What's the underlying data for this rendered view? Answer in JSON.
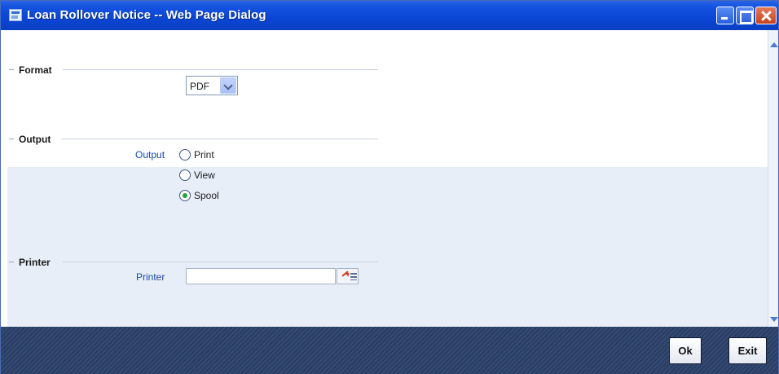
{
  "window": {
    "title": "Loan Rollover Notice -- Web Page Dialog"
  },
  "format_section": {
    "title": "Format",
    "select_value": "PDF"
  },
  "output_section": {
    "title": "Output",
    "field_label": "Output",
    "options": [
      {
        "label": "Print",
        "checked": false
      },
      {
        "label": "View",
        "checked": false
      },
      {
        "label": "Spool",
        "checked": true
      }
    ]
  },
  "printer_section": {
    "title": "Printer",
    "field_label": "Printer",
    "value": ""
  },
  "footer": {
    "ok_label": "Ok",
    "exit_label": "Exit"
  },
  "colors": {
    "titlebar": "#0a46d4",
    "footer": "#2a3d62",
    "lower_panel": "#e8eef7",
    "field_label": "#1a4aa8"
  }
}
